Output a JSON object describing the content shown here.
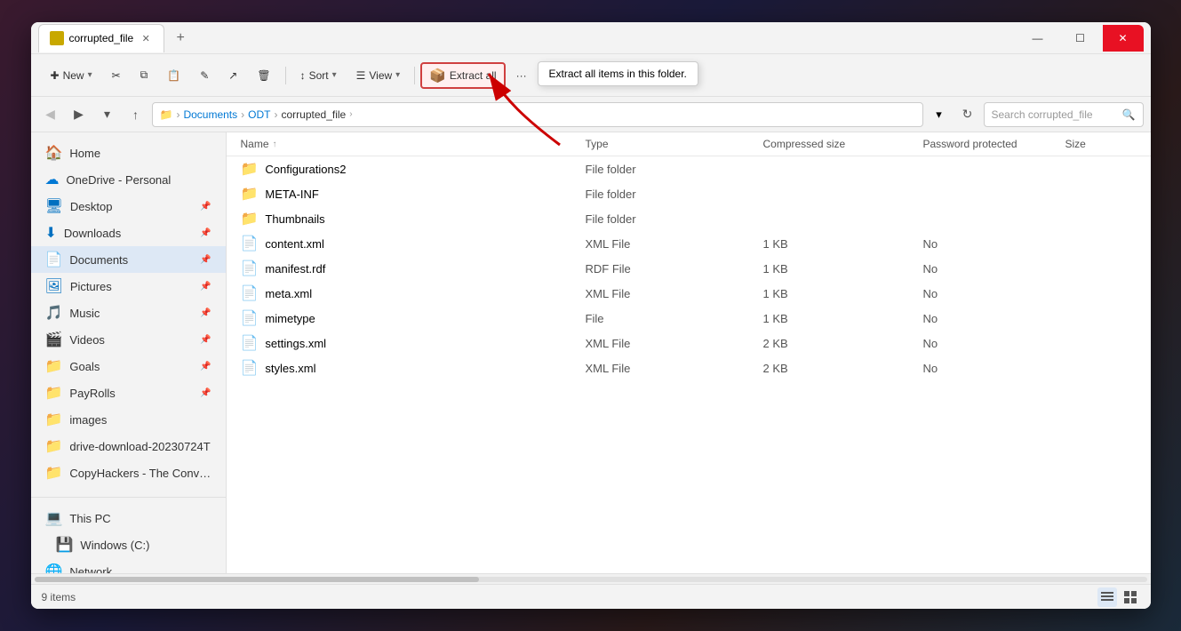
{
  "window": {
    "title": "corrupted_file",
    "tab_icon": "📁"
  },
  "toolbar": {
    "new_label": "New",
    "sort_label": "Sort",
    "view_label": "View",
    "extract_all_label": "Extract all",
    "more_label": "···",
    "tooltip": "Extract all items in this folder."
  },
  "address_bar": {
    "breadcrumbs": [
      "Documents",
      "ODT",
      "corrupted_file"
    ],
    "search_placeholder": "Search corrupted_file"
  },
  "sidebar": {
    "items": [
      {
        "label": "Home",
        "icon": "🏠",
        "pinned": false
      },
      {
        "label": "OneDrive - Personal",
        "icon": "☁️",
        "pinned": false
      },
      {
        "label": "Desktop",
        "icon": "🖥️",
        "pinned": true
      },
      {
        "label": "Downloads",
        "icon": "⬇️",
        "pinned": true
      },
      {
        "label": "Documents",
        "icon": "📄",
        "pinned": true,
        "active": true
      },
      {
        "label": "Pictures",
        "icon": "🖼️",
        "pinned": true
      },
      {
        "label": "Music",
        "icon": "🎵",
        "pinned": true
      },
      {
        "label": "Videos",
        "icon": "🎬",
        "pinned": true
      },
      {
        "label": "Goals",
        "icon": "📁",
        "pinned": true
      },
      {
        "label": "PayRolls",
        "icon": "📁",
        "pinned": true
      },
      {
        "label": "images",
        "icon": "📁",
        "pinned": false
      },
      {
        "label": "drive-download-20230724T",
        "icon": "📁",
        "pinned": false
      },
      {
        "label": "CopyHackers - The Convers",
        "icon": "📁",
        "pinned": false
      }
    ],
    "system_items": [
      {
        "label": "This PC",
        "icon": "💻"
      },
      {
        "label": "Windows (C:)",
        "icon": "💾"
      },
      {
        "label": "Network",
        "icon": "🌐"
      }
    ]
  },
  "file_list": {
    "headers": [
      "Name",
      "Type",
      "Compressed size",
      "Password protected",
      "Size"
    ],
    "files": [
      {
        "name": "Configurations2",
        "type": "File folder",
        "compressed_size": "",
        "protected": "",
        "size": "",
        "icon": "folder"
      },
      {
        "name": "META-INF",
        "type": "File folder",
        "compressed_size": "",
        "protected": "",
        "size": "",
        "icon": "folder"
      },
      {
        "name": "Thumbnails",
        "type": "File folder",
        "compressed_size": "",
        "protected": "",
        "size": "",
        "icon": "folder"
      },
      {
        "name": "content.xml",
        "type": "XML File",
        "compressed_size": "1 KB",
        "protected": "No",
        "size": "",
        "icon": "file"
      },
      {
        "name": "manifest.rdf",
        "type": "RDF File",
        "compressed_size": "1 KB",
        "protected": "No",
        "size": "",
        "icon": "file"
      },
      {
        "name": "meta.xml",
        "type": "XML File",
        "compressed_size": "1 KB",
        "protected": "No",
        "size": "",
        "icon": "file"
      },
      {
        "name": "mimetype",
        "type": "File",
        "compressed_size": "1 KB",
        "protected": "No",
        "size": "",
        "icon": "file"
      },
      {
        "name": "settings.xml",
        "type": "XML File",
        "compressed_size": "2 KB",
        "protected": "No",
        "size": "",
        "icon": "file"
      },
      {
        "name": "styles.xml",
        "type": "XML File",
        "compressed_size": "2 KB",
        "protected": "No",
        "size": "",
        "icon": "file"
      }
    ]
  },
  "status_bar": {
    "count": "9 items"
  },
  "window_controls": {
    "minimize": "—",
    "maximize": "☐",
    "close": "✕"
  }
}
